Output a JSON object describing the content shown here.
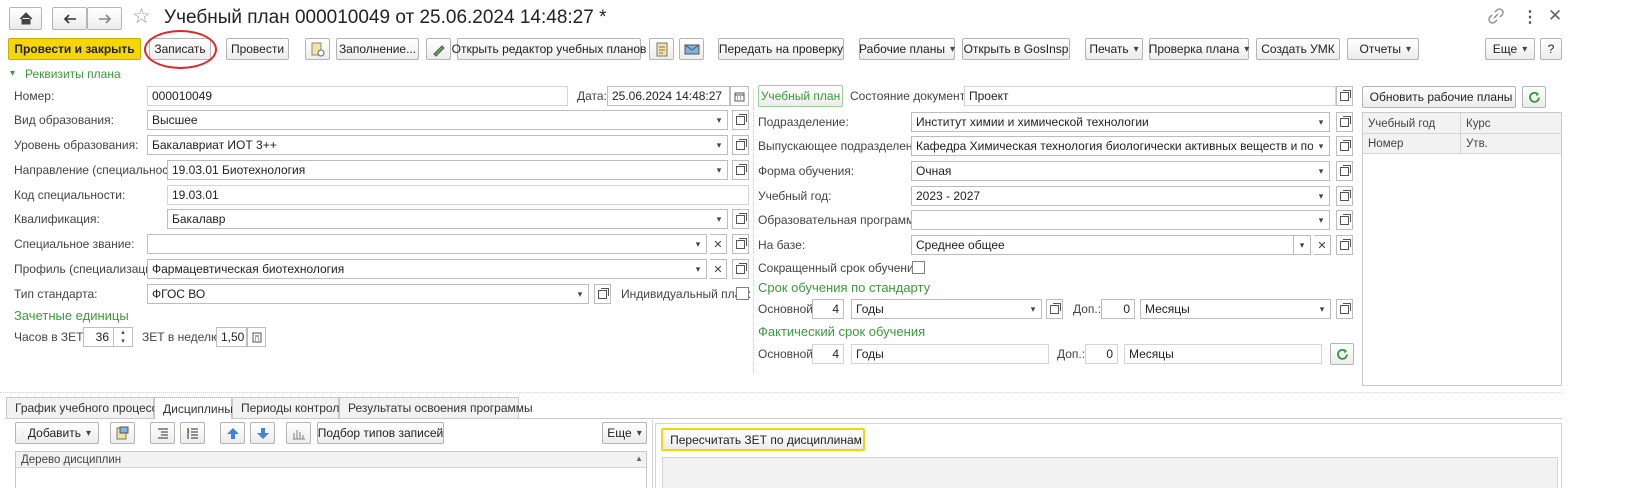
{
  "window": {
    "title": "Учебный план 000010049 от 25.06.2024 14:48:27 *"
  },
  "toolbar": {
    "post_close": "Провести и закрыть",
    "save": "Записать",
    "post": "Провести",
    "fill": "Заполнение...",
    "open_editor": "Открыть редактор учебных планов",
    "send_check": "Передать на проверку",
    "work_plans": "Рабочие планы",
    "open_gosinsp": "Открыть в GosInsp",
    "print": "Печать",
    "check_plan": "Проверка плана",
    "create_umk": "Создать УМК",
    "reports": "Отчеты",
    "more": "Еще",
    "help": "?"
  },
  "section": {
    "requisites": "Реквизиты плана"
  },
  "form": {
    "number_label": "Номер:",
    "number_value": "000010049",
    "date_label": "Дата:",
    "date_value": "25.06.2024 14:48:27",
    "edu_type_label": "Вид образования:",
    "edu_type_value": "Высшее",
    "edu_level_label": "Уровень образования:",
    "edu_level_value": "Бакалавриат ИОТ 3++",
    "direction_label": "Направление (специальность):",
    "direction_value": "19.03.01 Биотехнология",
    "spec_code_label": "Код специальности:",
    "spec_code_value": "19.03.01",
    "qualification_label": "Квалификация:",
    "qualification_value": "Бакалавр",
    "special_title_label": "Специальное звание:",
    "special_title_value": "",
    "profile_label": "Профиль (специализация):",
    "profile_value": "Фармацевтическая биотехнология",
    "standard_type_label": "Тип стандарта:",
    "standard_type_value": "ФГОС ВО",
    "individual_label": "Индивидуальный план:",
    "credits_header": "Зачетные единицы",
    "hours_label": "Часов в ЗЕТ:",
    "hours_value": "36",
    "zet_week_label": "ЗЕТ в неделю:",
    "zet_week_value": "1,50"
  },
  "middle": {
    "plan_button": "Учебный план",
    "doc_state_label": "Состояние документа:",
    "doc_state_value": "Проект",
    "division_label": "Подразделение:",
    "division_value": "Институт химии и химической технологии",
    "grad_division_label": "Выпускающее подразделение:",
    "grad_division_value": "Кафедра Химическая технология биологически активных веществ и полимерных",
    "study_form_label": "Форма обучения:",
    "study_form_value": "Очная",
    "study_year_label": "Учебный год:",
    "study_year_value": "2023 - 2027",
    "edu_program_label": "Образовательная программа:",
    "edu_program_value": "",
    "base_label": "На базе:",
    "base_value": "Среднее общее",
    "short_term_label": "Сокращенный срок обучения:",
    "standard_term_header": "Срок обучения по стандарту",
    "main_label": "Основной:",
    "std_main_value": "4",
    "std_main_unit": "Годы",
    "extra_label": "Доп.:",
    "std_extra_value": "0",
    "std_extra_unit": "Месяцы",
    "actual_term_header": "Фактический срок обучения",
    "act_main_value": "4",
    "act_main_unit": "Годы",
    "act_extra_value": "0",
    "act_extra_unit": "Месяцы"
  },
  "right_panel": {
    "update_button": "Обновить рабочие планы",
    "col_year": "Учебный год",
    "col_course": "Курс",
    "col_number": "Номер",
    "col_approved": "Утв."
  },
  "tabs": [
    {
      "label": "График учебного процесса"
    },
    {
      "label": "Дисциплины"
    },
    {
      "label": "Периоды контроля"
    },
    {
      "label": "Результаты освоения программы"
    }
  ],
  "bottom": {
    "add_button": "Добавить",
    "record_types_button": "Подбор типов записей",
    "more_button": "Еще",
    "recalc_button": "Пересчитать ЗЕТ по дисциплинам",
    "tree_header": "Дерево дисциплин"
  },
  "colors": {
    "accent_yellow": "#f5d60a",
    "green": "#3a9b3a",
    "highlight_red": "#e0262b"
  }
}
